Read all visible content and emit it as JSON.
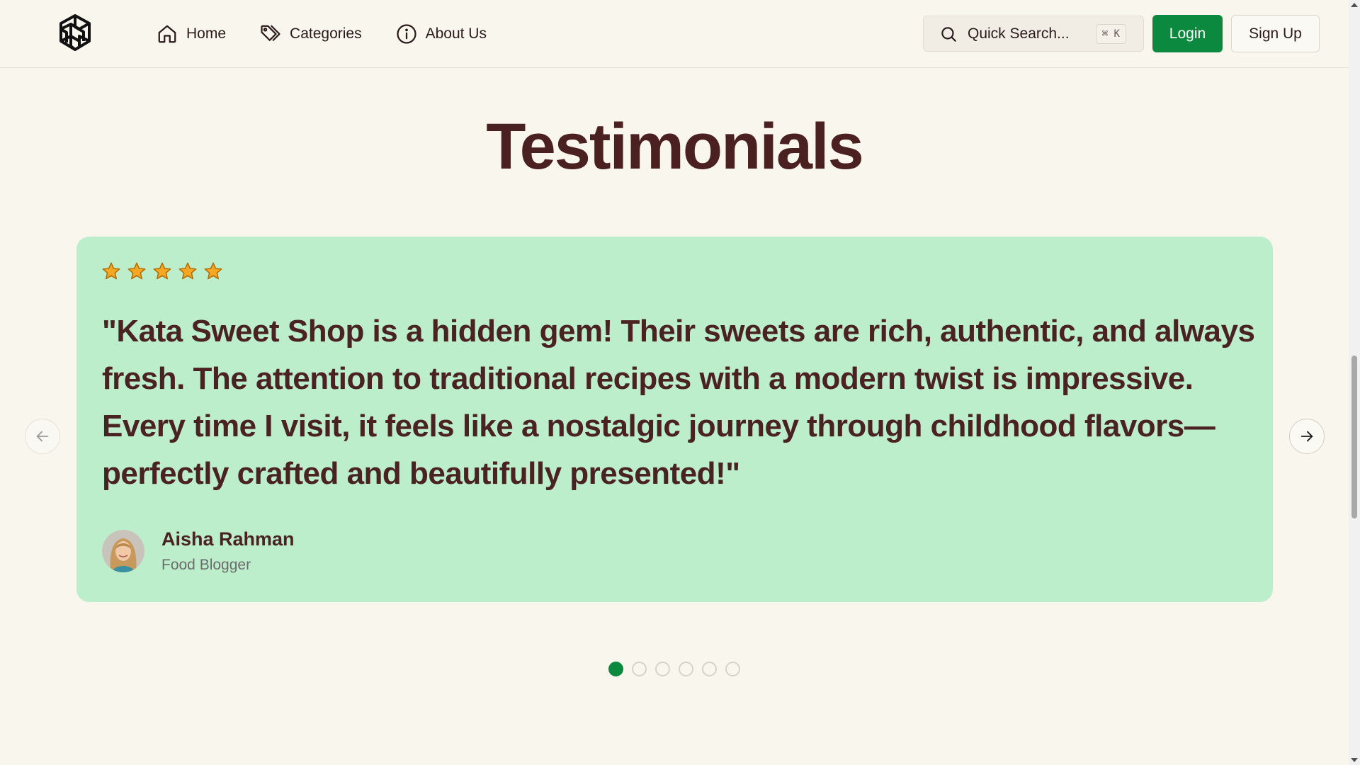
{
  "header": {
    "nav": [
      {
        "label": "Home",
        "icon": "home-icon"
      },
      {
        "label": "Categories",
        "icon": "tags-icon"
      },
      {
        "label": "About Us",
        "icon": "info-icon"
      }
    ],
    "search": {
      "label": "Quick Search...",
      "shortcut": "⌘ K"
    },
    "login_label": "Login",
    "signup_label": "Sign Up"
  },
  "section": {
    "title": "Testimonials"
  },
  "testimonial": {
    "rating": 5,
    "rating_max": 5,
    "quote": "\"Kata Sweet Shop is a hidden gem! Their sweets are rich, authentic, and always fresh. The attention to traditional recipes with a modern twist is impressive. Every time I visit, it feels like a nostalgic journey through childhood flavors—perfectly crafted and beautifully presented!\"",
    "author_name": "Aisha Rahman",
    "author_role": "Food Blogger"
  },
  "carousel": {
    "total_slides": 6,
    "active_index": 0
  },
  "colors": {
    "accent": "#0b8a3f",
    "card_bg": "#bdeecb",
    "heading": "#4a2020",
    "star": "#f5a623",
    "page_bg": "#f9f6ee"
  }
}
